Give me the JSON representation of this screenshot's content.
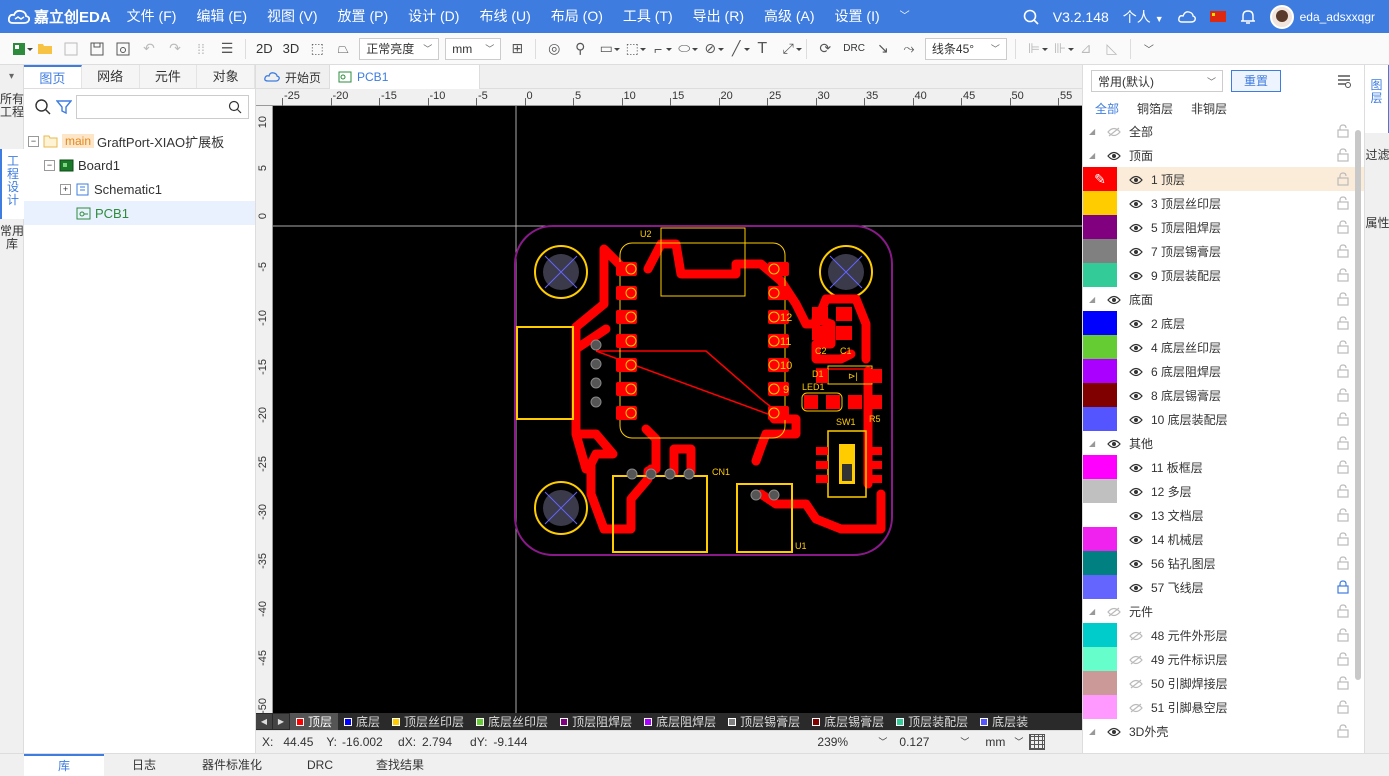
{
  "app": {
    "logo_text": "嘉立创EDA",
    "version": "V3.2.148",
    "account_mode": "个人",
    "username": "eda_adsxxqgr"
  },
  "menu": [
    "文件 (F)",
    "编辑 (E)",
    "视图 (V)",
    "放置 (P)",
    "设计 (D)",
    "布线 (U)",
    "布局 (O)",
    "工具 (T)",
    "导出 (R)",
    "高级 (A)",
    "设置 (I)"
  ],
  "toolbar": {
    "view_2d": "2D",
    "view_3d": "3D",
    "brightness": "正常亮度",
    "unit": "mm",
    "drc": "DRC",
    "route_mode": "线条45°"
  },
  "left_vtabs": [
    "所有工程",
    "工程设计",
    "常用库"
  ],
  "left_panel": {
    "tabs": [
      "图页",
      "网络",
      "元件",
      "对象"
    ],
    "tree": {
      "tag": "main",
      "project": "GraftPort-XIAO扩展板",
      "board": "Board1",
      "schematic": "Schematic1",
      "pcb": "PCB1"
    }
  },
  "doc_tabs": [
    "开始页",
    "PCB1"
  ],
  "ruler": {
    "h": [
      "-25",
      "-20",
      "-15",
      "-10",
      "-5",
      "0",
      "5",
      "10",
      "15",
      "20",
      "25",
      "30",
      "35",
      "40",
      "45",
      "50",
      "55"
    ],
    "v": [
      "10",
      "5",
      "0",
      "-5",
      "-10",
      "-15",
      "-20",
      "-25",
      "-30",
      "-35",
      "-40",
      "-45",
      "-50"
    ]
  },
  "pcb_labels": {
    "u2": "U2",
    "c2": "C2",
    "c1": "C1",
    "d1": "D1",
    "led1": "LED1",
    "sw1": "SW1",
    "r5": "R5",
    "cn1": "CN1",
    "u1": "U1",
    "pin12": "12",
    "pin11": "11",
    "pin10": "10",
    "pin9": "9"
  },
  "layer_bar": [
    {
      "name": "顶层",
      "color": "#ff0000"
    },
    {
      "name": "底层",
      "color": "#0000ff"
    },
    {
      "name": "顶层丝印层",
      "color": "#ffcc00"
    },
    {
      "name": "底层丝印层",
      "color": "#66cc33"
    },
    {
      "name": "顶层阻焊层",
      "color": "#800080"
    },
    {
      "name": "底层阻焊层",
      "color": "#aa00ff"
    },
    {
      "name": "顶层锡膏层",
      "color": "#808080"
    },
    {
      "name": "底层锡膏层",
      "color": "#800000"
    },
    {
      "name": "顶层装配层",
      "color": "#33cc99"
    },
    {
      "name": "底层装",
      "color": "#5555ff"
    }
  ],
  "status": {
    "x_label": "X:",
    "x": "44.45",
    "y_label": "Y:",
    "y": "-16.002",
    "dx_label": "dX:",
    "dx": "2.794",
    "dy_label": "dY:",
    "dy": "-9.144",
    "zoom": "239%",
    "grid": "0.127",
    "unit": "mm"
  },
  "bottom_tabs": [
    "库",
    "日志",
    "器件标准化",
    "DRC",
    "查找结果"
  ],
  "right_panel": {
    "preset": "常用(默认)",
    "reset": "重置",
    "filters": [
      "全部",
      "铜箔层",
      "非铜层"
    ],
    "layers": [
      {
        "type": "group",
        "name": "全部",
        "hidden": true
      },
      {
        "type": "group",
        "name": "顶面"
      },
      {
        "type": "layer",
        "name": "1 顶层",
        "color": "#ff0000",
        "active": true
      },
      {
        "type": "layer",
        "name": "3 顶层丝印层",
        "color": "#ffcc00"
      },
      {
        "type": "layer",
        "name": "5 顶层阻焊层",
        "color": "#800080"
      },
      {
        "type": "layer",
        "name": "7 顶层锡膏层",
        "color": "#808080"
      },
      {
        "type": "layer",
        "name": "9 顶层装配层",
        "color": "#33cc99"
      },
      {
        "type": "group",
        "name": "底面"
      },
      {
        "type": "layer",
        "name": "2 底层",
        "color": "#0000ff"
      },
      {
        "type": "layer",
        "name": "4 底层丝印层",
        "color": "#66cc33"
      },
      {
        "type": "layer",
        "name": "6 底层阻焊层",
        "color": "#aa00ff"
      },
      {
        "type": "layer",
        "name": "8 底层锡膏层",
        "color": "#800000"
      },
      {
        "type": "layer",
        "name": "10 底层装配层",
        "color": "#5555ff"
      },
      {
        "type": "group",
        "name": "其他"
      },
      {
        "type": "layer",
        "name": "11 板框层",
        "color": "#ff00ff"
      },
      {
        "type": "layer",
        "name": "12 多层",
        "color": "#c0c0c0"
      },
      {
        "type": "layer",
        "name": "13 文档层",
        "color": "#ffffff"
      },
      {
        "type": "layer",
        "name": "14 机械层",
        "color": "#f022f0"
      },
      {
        "type": "layer",
        "name": "56 钻孔图层",
        "color": "#008080"
      },
      {
        "type": "layer",
        "name": "57 飞线层",
        "color": "#6464ff",
        "locked": true
      },
      {
        "type": "group",
        "name": "元件",
        "hidden": true
      },
      {
        "type": "layer",
        "name": "48 元件外形层",
        "color": "#00cccc",
        "hidden": true
      },
      {
        "type": "layer",
        "name": "49 元件标识层",
        "color": "#66ffcc",
        "hidden": true
      },
      {
        "type": "layer",
        "name": "50 引脚焊接层",
        "color": "#cc9999",
        "hidden": true
      },
      {
        "type": "layer",
        "name": "51 引脚悬空层",
        "color": "#ff99ff",
        "hidden": true
      },
      {
        "type": "group",
        "name": "3D外壳"
      }
    ]
  },
  "right_vtabs": [
    "图层",
    "过滤",
    "属性"
  ]
}
